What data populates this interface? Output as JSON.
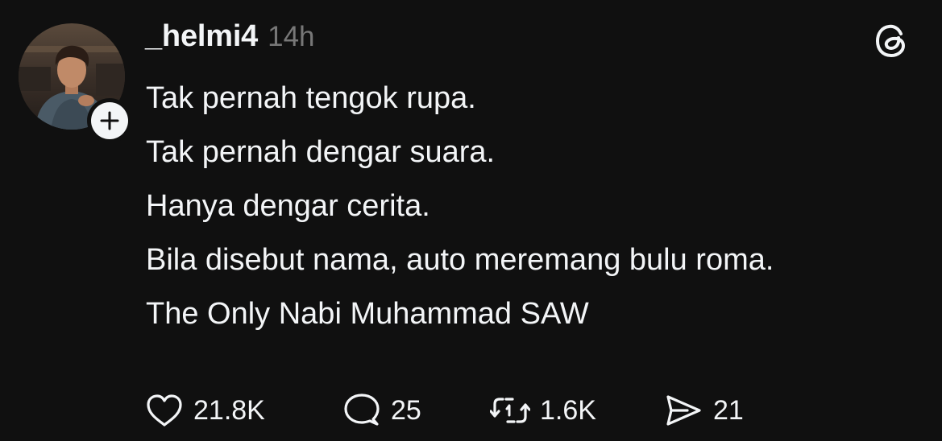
{
  "post": {
    "username": "_helmi4",
    "time": "14h",
    "lines": [
      "Tak pernah tengok rupa.",
      "Tak pernah dengar suara.",
      "Hanya dengar cerita.",
      "Bila disebut nama, auto meremang bulu roma.",
      "The Only Nabi Muhammad SAW"
    ],
    "actions": {
      "likes": "21.8K",
      "replies": "25",
      "reposts": "1.6K",
      "shares": "21"
    }
  },
  "icons": {
    "avatar": "profile-photo",
    "follow": "plus-icon",
    "app": "threads-logo-icon",
    "like": "heart-icon",
    "reply": "speech-bubble-icon",
    "repost": "repost-arrows-icon",
    "share": "send-icon"
  },
  "colors": {
    "background": "#101010",
    "text": "#f3f5f7",
    "muted": "#777777"
  }
}
